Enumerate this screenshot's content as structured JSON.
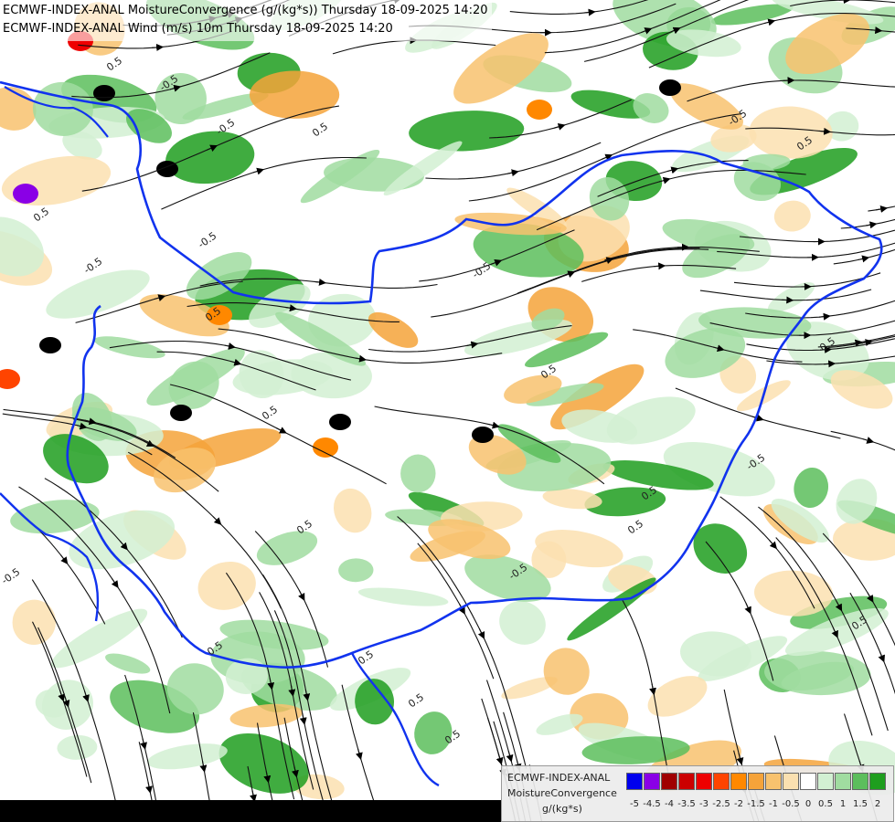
{
  "title": {
    "line1": "ECMWF-INDEX-ANAL MoistureConvergence (g/(kg*s)) Thursday 18-09-2025 14:20",
    "line2": "ECMWF-INDEX-ANAL Wind (m/s) 10m Thursday 18-09-2025 14:20"
  },
  "legend": {
    "model": "ECMWF-INDEX-ANAL",
    "parameter": "MoistureConvergence",
    "unit": "g/(kg*s)",
    "ticks": [
      "-5",
      "-4.5",
      "-4",
      "-3.5",
      "-3",
      "-2.5",
      "-2",
      "-1.5",
      "-1",
      "-0.5",
      "0",
      "0.5",
      "1",
      "1.5",
      "2"
    ],
    "colors": [
      "#0000ee",
      "#8a00e6",
      "#a00000",
      "#cc0000",
      "#ee0000",
      "#ff4400",
      "#ff8800",
      "#f5a33a",
      "#f8c26e",
      "#fbe0b0",
      "#ffffff",
      "#d2f0d2",
      "#a0dca0",
      "#5cbe5c",
      "#1e9e1e"
    ]
  },
  "contour_labels": [
    "-0.5",
    "0.5",
    "-0.5",
    "0.5",
    "-0.5",
    "0.5",
    "-0.5",
    "0.5",
    "0.5",
    "-0.5",
    "0.5",
    "0.5",
    "0.5",
    "-0.5",
    "0.5",
    "0.5",
    "-0.5",
    "0.5",
    "0.5",
    "0.5",
    "0.5",
    "-0.5",
    "-0.5",
    "0.5",
    "0.5"
  ]
}
